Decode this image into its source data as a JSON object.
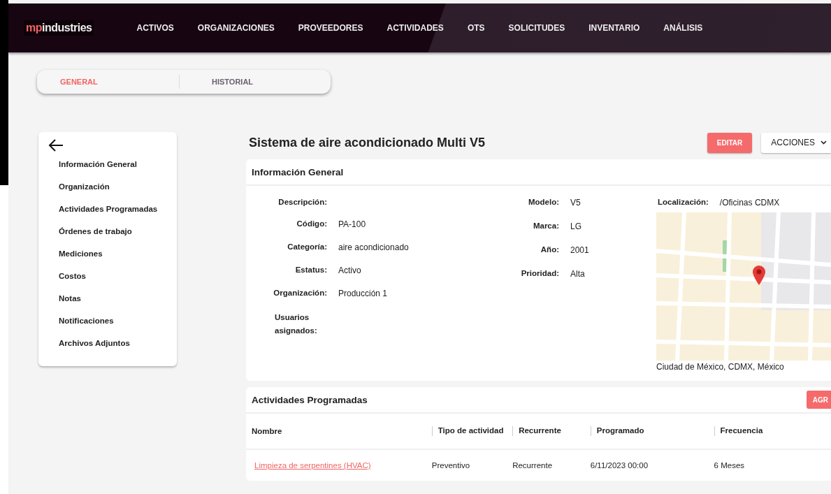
{
  "header": {
    "logo": {
      "prefix": "mp",
      "rest": "industries"
    },
    "nav": [
      {
        "label": "ACTIVOS",
        "selected": false
      },
      {
        "label": "ORGANIZACIONES",
        "selected": false
      },
      {
        "label": "PROVEEDORES",
        "selected": false
      },
      {
        "label": "ACTIVIDADES",
        "selected": false
      },
      {
        "label": "OTS",
        "selected": false
      },
      {
        "label": "SOLICITUDES",
        "selected": false
      },
      {
        "label": "INVENTARIO",
        "selected": false
      },
      {
        "label": "ANÁLISIS",
        "selected": false
      }
    ]
  },
  "tabs": [
    {
      "label": "GENERAL",
      "selected": true
    },
    {
      "label": "HISTORIAL",
      "selected": false
    }
  ],
  "sidebar": {
    "items": [
      "Información General",
      "Organización",
      "Actividades Programadas",
      "Órdenes de trabajo",
      "Mediciones",
      "Costos",
      "Notas",
      "Notificaciones",
      "Archivos Adjuntos"
    ]
  },
  "asset": {
    "title": "Sistema de aire acondicionado Multi V5",
    "buttons": {
      "edit": "EDITAR",
      "actions": "ACCIONES"
    }
  },
  "general_info": {
    "title": "Información General",
    "column_1": [
      {
        "label": "Descripción:"
      },
      {
        "label": "Código:",
        "value": "PA-100"
      },
      {
        "label": "Categoría:",
        "value": "aire acondicionado"
      },
      {
        "label": "Estatus:",
        "value": "Activo"
      },
      {
        "label": "Organización:",
        "value": "Producción 1"
      }
    ],
    "assigned_users_label": "Usuarios asignados:",
    "column_2": [
      {
        "label": "Modelo:",
        "value": "V5"
      },
      {
        "label": "Marca:",
        "value": "LG"
      },
      {
        "label": "Año:",
        "value": "2001"
      },
      {
        "label": "Prioridad:",
        "value": "Alta"
      }
    ],
    "location": {
      "label": "Localización:",
      "value": "/Oficinas CDMX",
      "address": "Ciudad de México, CDMX, México"
    }
  },
  "scheduled_activities": {
    "title": "Actividades Programadas",
    "add_button": "AGR",
    "table": {
      "columns": [
        "Nombre",
        "Tipo de actividad",
        "Recurrente",
        "Programado",
        "Frecuencia"
      ],
      "rows": [
        [
          "Limpieza de serpentines (HVAC)",
          "Preventivo",
          "Recurrente",
          "6/11/2023 00:00",
          "6 Meses"
        ]
      ]
    }
  }
}
